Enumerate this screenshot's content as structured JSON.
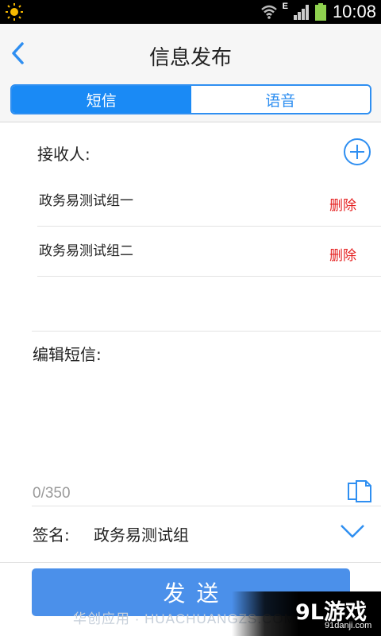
{
  "status_bar": {
    "network_label": "E",
    "time": "10:08",
    "icons": [
      "brightness-icon",
      "wifi-icon",
      "signal-icon",
      "battery-icon"
    ]
  },
  "header": {
    "title": "信息发布",
    "back_icon": "chevron-left-icon"
  },
  "tabs": [
    {
      "label": "短信",
      "active": true
    },
    {
      "label": "语音",
      "active": false
    }
  ],
  "recipients": {
    "label": "接收人:",
    "add_icon": "add-circle-icon",
    "items": [
      {
        "name": "政务易测试组一",
        "delete_label": "删除"
      },
      {
        "name": "政务易测试组二",
        "delete_label": "删除"
      }
    ]
  },
  "message": {
    "label": "编辑短信:",
    "value": "",
    "counter": "0/350",
    "paste_icon": "paste-icon"
  },
  "signature": {
    "label": "签名:",
    "value": "政务易测试组",
    "dropdown_icon": "chevron-down-icon"
  },
  "send_button": {
    "label": "发送"
  },
  "watermark": {
    "text": "华创应用 · HUACHUANGZS.COM",
    "logo": "9L游戏",
    "logo_sub": "91danji.com"
  },
  "colors": {
    "accent": "#1a8af5",
    "send_button": "#4b90ea",
    "delete": "#e52020"
  }
}
